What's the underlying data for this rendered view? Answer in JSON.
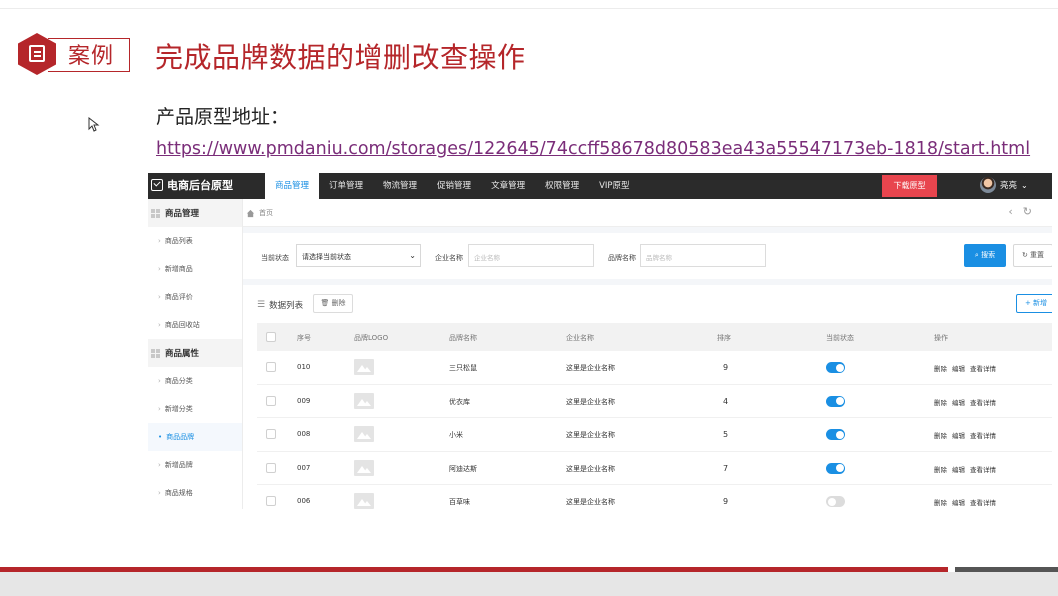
{
  "slide": {
    "badge": "案例",
    "title": "完成品牌数据的增删改查操作",
    "subtitle": "产品原型地址：",
    "url": "https://www.pmdaniu.com/storages/122645/74ccff58678d80583ea43a55547173eb-1818/start.html"
  },
  "app": {
    "logo": "电商后台原型",
    "nav": [
      "商品管理",
      "订单管理",
      "物流管理",
      "促销管理",
      "文章管理",
      "权限管理",
      "VIP原型"
    ],
    "download": "下载原型",
    "user": "亮亮",
    "sidebar": {
      "group1": "商品管理",
      "group1_items": [
        "商品列表",
        "新增商品",
        "商品评价",
        "商品回收站"
      ],
      "group2": "商品属性",
      "group2_items": [
        "商品分类",
        "新增分类",
        "商品品牌",
        "新增品牌",
        "商品规格"
      ]
    },
    "breadcrumb": "首页",
    "filter": {
      "status_label": "当前状态",
      "status_value": "请选择当前状态",
      "company_label": "企业名称",
      "company_placeholder": "企业名称",
      "brand_label": "品牌名称",
      "brand_placeholder": "品牌名称",
      "search": "搜索",
      "reset": "重置"
    },
    "list": {
      "title": "数据列表",
      "delete": "删除",
      "add": "新增",
      "columns": [
        "序号",
        "品牌LOGO",
        "品牌名称",
        "企业名称",
        "排序",
        "当前状态",
        "操作"
      ],
      "rows": [
        {
          "id": "010",
          "brand": "三只松鼠",
          "company": "这里是企业名称",
          "sort": "9",
          "on": true
        },
        {
          "id": "009",
          "brand": "优衣库",
          "company": "这里是企业名称",
          "sort": "4",
          "on": true
        },
        {
          "id": "008",
          "brand": "小米",
          "company": "这里是企业名称",
          "sort": "5",
          "on": true
        },
        {
          "id": "007",
          "brand": "阿迪达斯",
          "company": "这里是企业名称",
          "sort": "7",
          "on": true
        },
        {
          "id": "006",
          "brand": "百草味",
          "company": "这里是企业名称",
          "sort": "9",
          "on": false
        }
      ],
      "ops": [
        "删除",
        "编辑",
        "查看详情"
      ]
    }
  },
  "colors": {
    "accent": "#b5262a",
    "primary": "#1a8fe3",
    "link": "#7a2d79"
  }
}
